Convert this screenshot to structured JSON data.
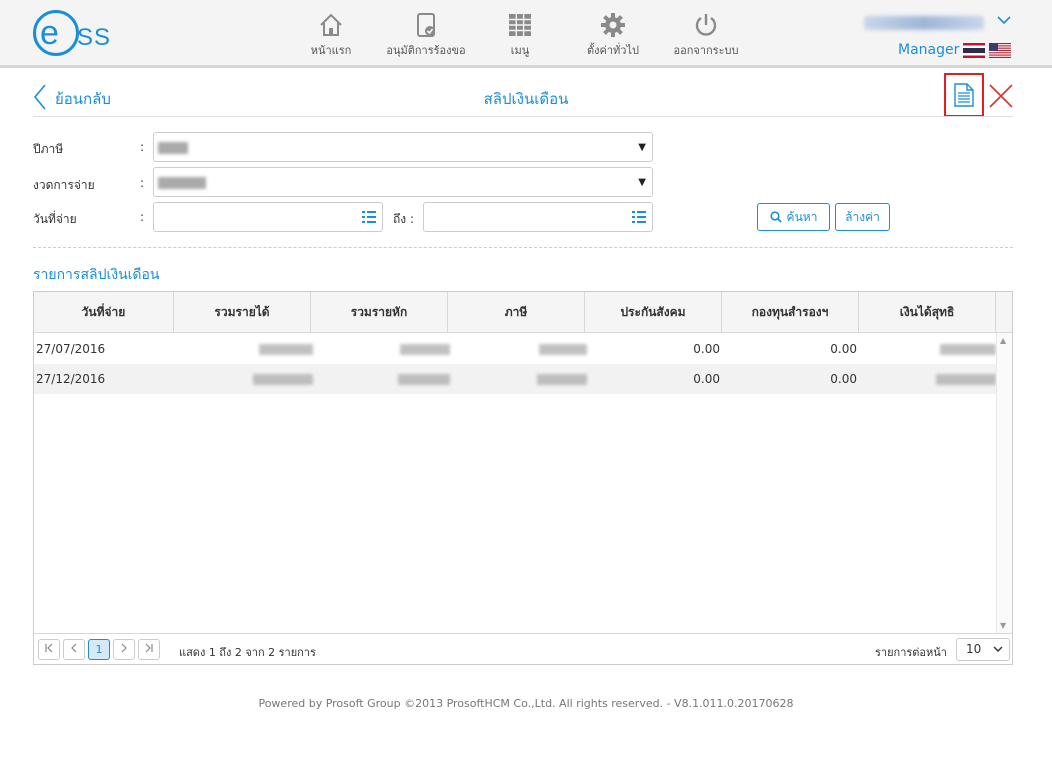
{
  "logo": {
    "letter": "e",
    "text": "SS"
  },
  "nav": [
    {
      "label": "หน้าแรก",
      "icon": "home-icon"
    },
    {
      "label": "อนุมัติการร้องขอ",
      "icon": "approve-document-icon"
    },
    {
      "label": "เมนู",
      "icon": "grid-menu-icon"
    },
    {
      "label": "ตั้งค่าทั่วไป",
      "icon": "gear-icon"
    },
    {
      "label": "ออกจากระบบ",
      "icon": "power-icon"
    }
  ],
  "user": {
    "role": "Manager"
  },
  "page": {
    "back_label": "ย้อนกลับ",
    "title": "สลิปเงินเดือน"
  },
  "form": {
    "year_label": "ปีภาษี",
    "period_label": "งวดการจ่าย",
    "paydate_label": "วันที่จ่าย",
    "to_label": "ถึง :",
    "colon": ":",
    "search_label": "ค้นหา",
    "clear_label": "ล้างค่า"
  },
  "section_title": "รายการสลิปเงินเดือน",
  "table": {
    "columns": [
      "วันที่จ่าย",
      "รวมรายได้",
      "รวมรายหัก",
      "ภาษี",
      "ประกันสังคม",
      "กองทุนสำรองฯ",
      "เงินได้สุทธิ"
    ],
    "rows": [
      {
        "date": "27/07/2016",
        "social_security": "0.00",
        "provident_fund": "0.00"
      },
      {
        "date": "27/12/2016",
        "social_security": "0.00",
        "provident_fund": "0.00"
      }
    ]
  },
  "pager": {
    "current_page": "1",
    "info": "แสดง 1 ถึง 2 จาก 2 รายการ",
    "page_size_label": "รายการต่อหน้า",
    "page_size": "10"
  },
  "footer": "Powered by Prosoft Group ©2013 ProsoftHCM Co.,Ltd. All rights reserved. - V8.1.011.0.20170628",
  "colors": {
    "accent": "#1a8fd6",
    "highlight_border": "#e02020"
  }
}
